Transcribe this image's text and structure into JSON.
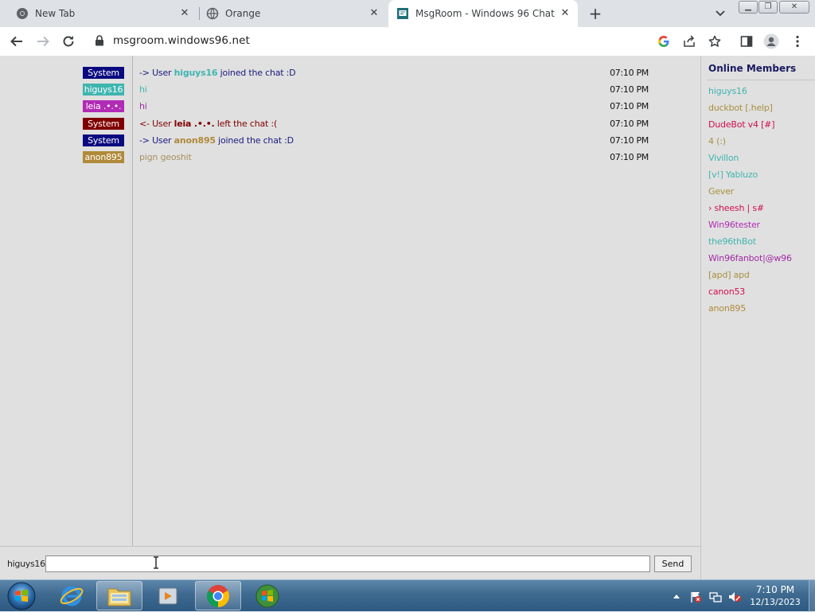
{
  "browser": {
    "tabs": [
      {
        "title": "New Tab",
        "active": false
      },
      {
        "title": "Orange",
        "active": false
      },
      {
        "title": "MsgRoom - Windows 96 Chat",
        "active": true
      }
    ],
    "url": "msgroom.windows96.net"
  },
  "chat": {
    "messages": [
      {
        "time": "07:10 PM",
        "sender": "System",
        "badge_color": "#0a0a80",
        "prefix": "-> User ",
        "user": "higuys16",
        "user_color": "#3fb5b0",
        "suffix": " joined the chat :D",
        "text_color": "#1a1a80"
      },
      {
        "time": "07:10 PM",
        "sender": "higuys16",
        "badge_color": "#3fb5b0",
        "text": "hi",
        "text_color": "#3fb5b0"
      },
      {
        "time": "07:10 PM",
        "sender": "leia .•.•.",
        "badge_color": "#b12bb5",
        "text": "hi",
        "text_color": "#a02aa5"
      },
      {
        "time": "07:10 PM",
        "sender": "System",
        "badge_color": "#800000",
        "prefix": "<- User ",
        "user": "leia .•.•.",
        "user_color": "#800000",
        "suffix": " left the chat :(",
        "text_color": "#800000"
      },
      {
        "time": "07:10 PM",
        "sender": "System",
        "badge_color": "#0a0a80",
        "prefix": "-> User ",
        "user": "anon895",
        "user_color": "#b08a3a",
        "suffix": " joined the chat :D",
        "text_color": "#1a1a80"
      },
      {
        "time": "07:10 PM",
        "sender": "anon895",
        "badge_color": "#b08a3a",
        "text": "pign geoshit",
        "text_color": "#a89060"
      }
    ],
    "nickname": "higuys16",
    "input_value": "",
    "send_label": "Send"
  },
  "members": {
    "title": "Online Members",
    "list": [
      {
        "name": "higuys16",
        "color": "#3fb5b0"
      },
      {
        "name": "duckbot [.help]",
        "color": "#a89040"
      },
      {
        "name": "DudeBot v4 [#]",
        "color": "#d01050"
      },
      {
        "name": "4 (:)",
        "color": "#a89040"
      },
      {
        "name": "Vivillon",
        "color": "#3fb5b0"
      },
      {
        "name": "[v!] Yabluzo",
        "color": "#3fb5b0"
      },
      {
        "name": "Gever",
        "color": "#a89040"
      },
      {
        "name": "› sheesh | s#",
        "color": "#d01050"
      },
      {
        "name": "Win96tester",
        "color": "#b12bb5"
      },
      {
        "name": "the96thBot",
        "color": "#3fb5b0"
      },
      {
        "name": "Win96fanbot|@w96",
        "color": "#a02aa5"
      },
      {
        "name": "[apd] apd",
        "color": "#a89040"
      },
      {
        "name": "canon53",
        "color": "#d01050"
      },
      {
        "name": "anon895",
        "color": "#b08a3a"
      }
    ]
  },
  "taskbar": {
    "clock_time": "7:10 PM",
    "clock_date": "12/13/2023"
  }
}
